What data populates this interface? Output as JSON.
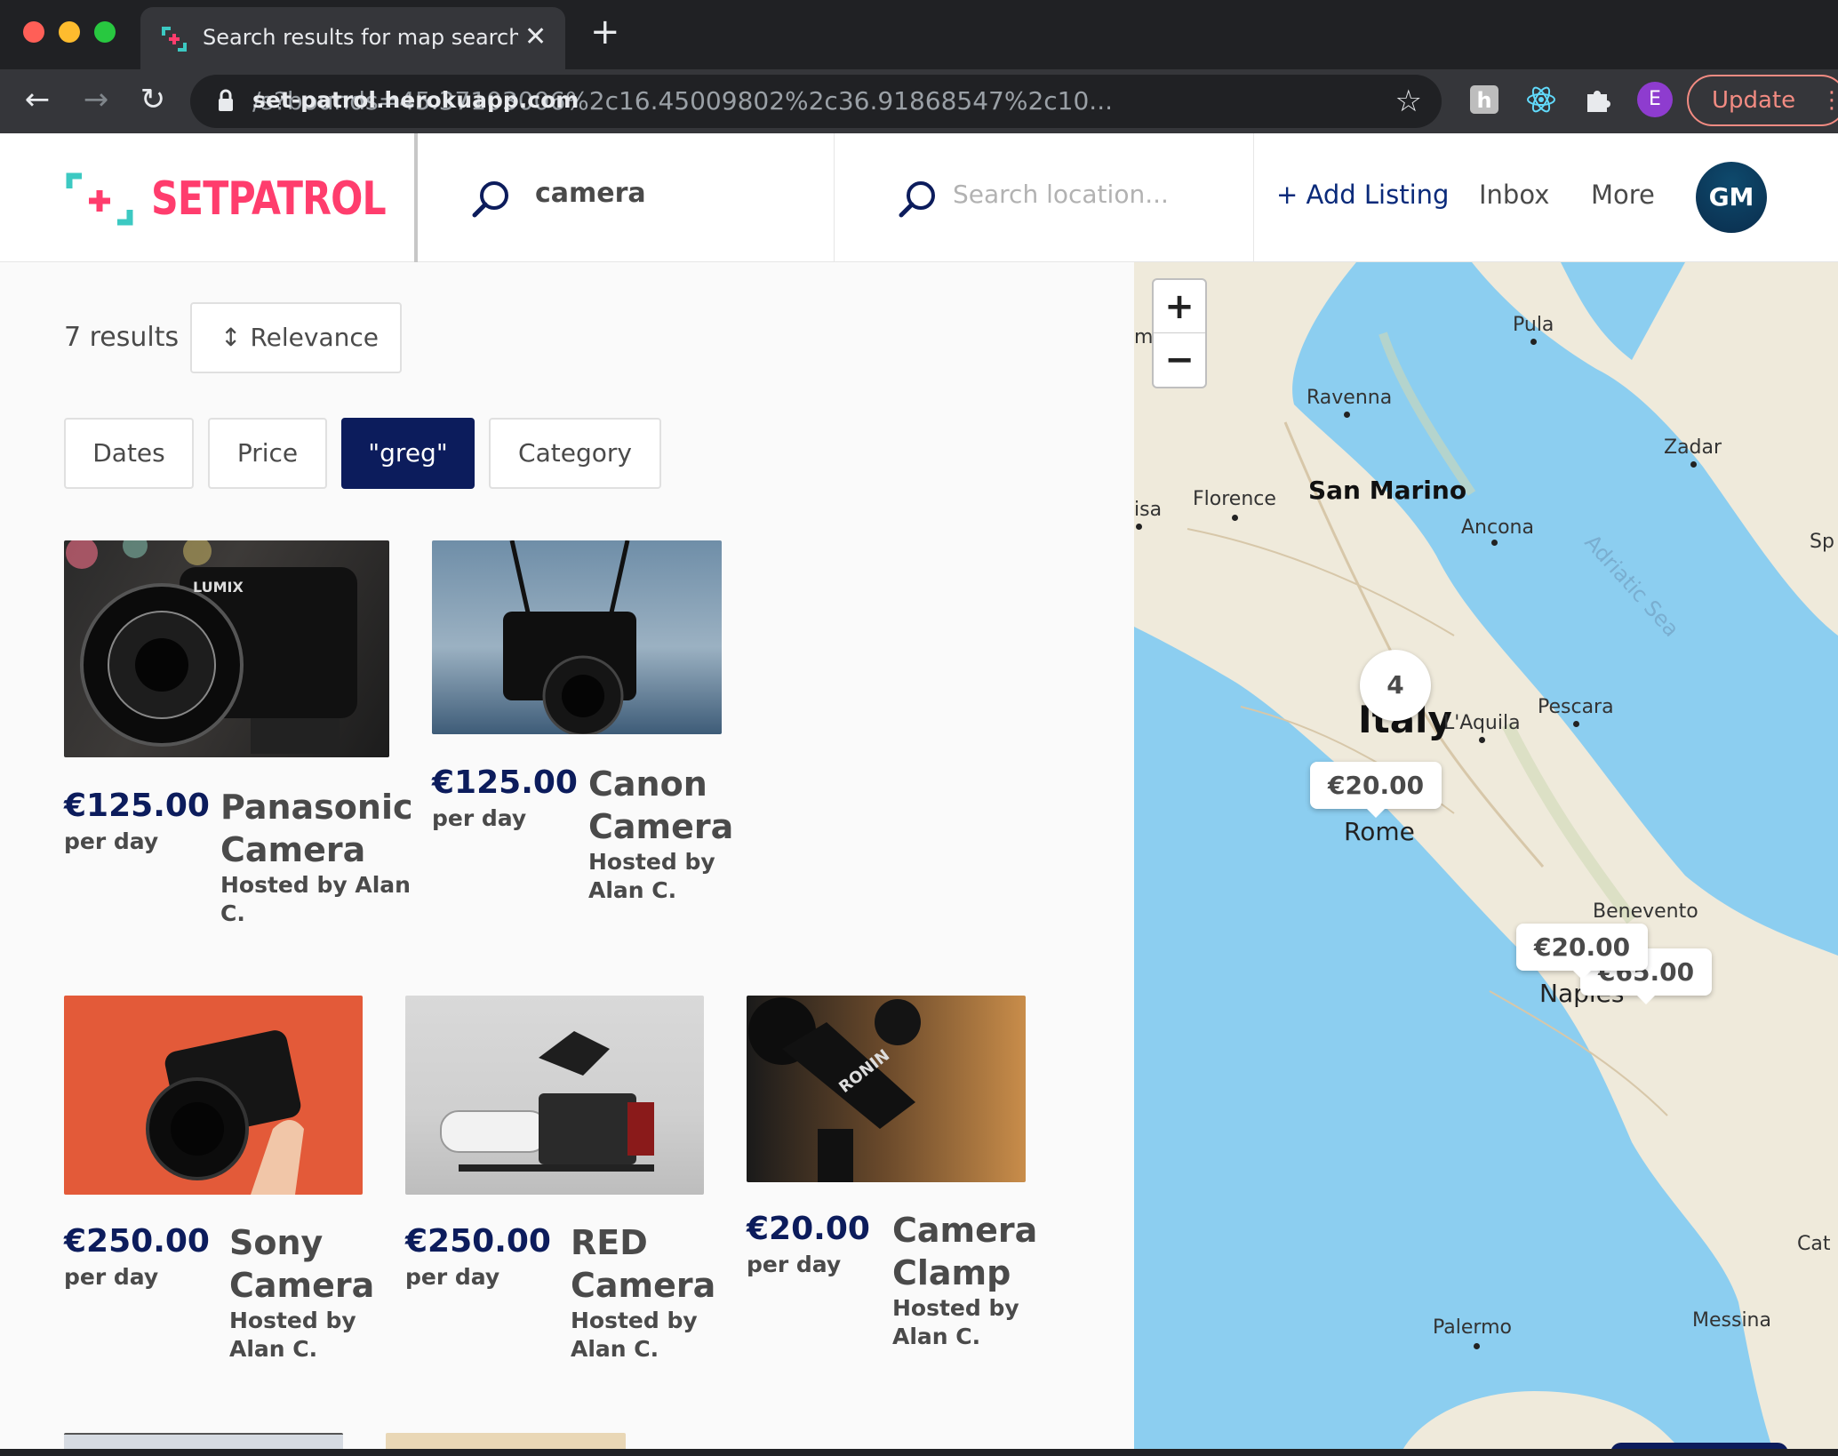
{
  "browser": {
    "tab_title": "Search results for map search | S",
    "url_host": "set-patrol.herokuapp.com",
    "url_path": "/s?bounds=45.37103006%2c16.45009802%2c36.91868547%2c10...",
    "profile_initial": "E",
    "update_label": "Update"
  },
  "header": {
    "logo_text": "SETPATROL",
    "search_value": "camera",
    "location_placeholder": "Search location...",
    "add_listing": "+ Add Listing",
    "inbox": "Inbox",
    "more": "More",
    "avatar_initials": "GM"
  },
  "results": {
    "count": "7 results",
    "sort_label": "Relevance"
  },
  "filters": {
    "dates": "Dates",
    "price": "Price",
    "keyword": "\"greg\"",
    "category": "Category"
  },
  "listings": [
    {
      "price": "€125.00",
      "per": "per day",
      "title_line1": "Panasonic",
      "title_line2": "Camera",
      "host_line1": "Hosted by Alan",
      "host_line2": "C."
    },
    {
      "price": "€125.00",
      "per": "per day",
      "title_line1": "Canon",
      "title_line2": "Camera",
      "host_line1": "Hosted by",
      "host_line2": "Alan C."
    },
    {
      "price": "€250.00",
      "per": "per day",
      "title_line1": "Sony",
      "title_line2": "Camera",
      "host_line1": "Hosted by",
      "host_line2": "Alan C."
    },
    {
      "price": "€250.00",
      "per": "per day",
      "title_line1": "RED",
      "title_line2": "Camera",
      "host_line1": "Hosted by",
      "host_line2": "Alan C."
    },
    {
      "price": "€20.00",
      "per": "per day",
      "title_line1": "Camera",
      "title_line2": "Clamp",
      "host_line1": "Hosted by",
      "host_line2": "Alan C."
    }
  ],
  "map": {
    "zoom_in": "+",
    "zoom_out": "−",
    "cluster_count": "4",
    "marker_rome": "€20.00",
    "marker_naples_a": "€20.00",
    "marker_naples_b": "€65.00",
    "labels": {
      "pula": "Pula",
      "ravenna": "Ravenna",
      "zadar": "Zadar",
      "san_marino": "San Marino",
      "florence": "Florence",
      "pisa": "isa",
      "ancona": "Ancona",
      "split": "Sp",
      "adriatic": "Adriatic Sea",
      "italy": "Italy",
      "laquila": "L'Aquila",
      "pescara": "Pescara",
      "rome": "Rome",
      "benevento": "Benevento",
      "naples": "Naples",
      "palermo": "Palermo",
      "messina": "Messina",
      "catania": "Cat",
      "left_edge": "m"
    }
  },
  "colors": {
    "brand_pink": "#ff3d6d",
    "brand_teal": "#3cc9c2",
    "navy": "#0c1c5c",
    "water": "#8ccef0",
    "land": "#efeadb"
  }
}
